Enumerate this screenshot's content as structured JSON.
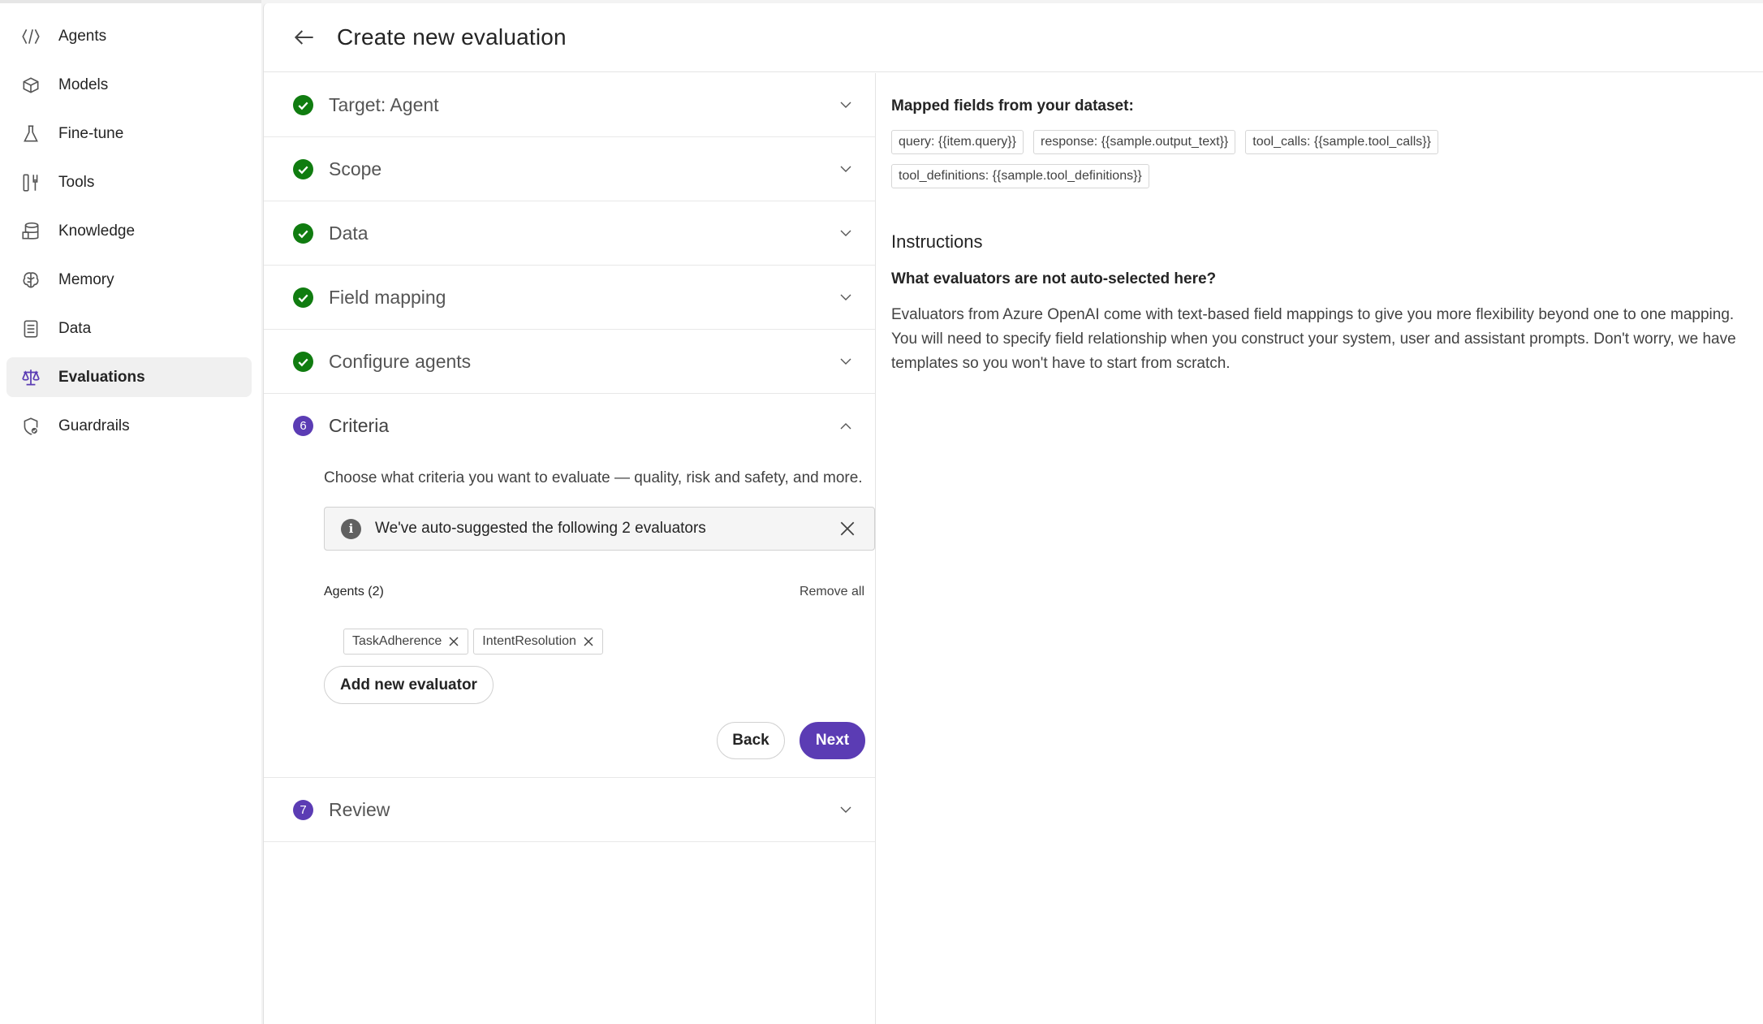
{
  "sidebar": {
    "items": [
      {
        "label": "Agents",
        "icon": "agents-icon"
      },
      {
        "label": "Models",
        "icon": "models-icon"
      },
      {
        "label": "Fine-tune",
        "icon": "flask-icon"
      },
      {
        "label": "Tools",
        "icon": "tools-icon"
      },
      {
        "label": "Knowledge",
        "icon": "database-icon"
      },
      {
        "label": "Memory",
        "icon": "brain-icon"
      },
      {
        "label": "Data",
        "icon": "document-icon"
      },
      {
        "label": "Evaluations",
        "icon": "scales-icon",
        "active": true
      },
      {
        "label": "Guardrails",
        "icon": "shield-check-icon"
      }
    ]
  },
  "header": {
    "title": "Create new evaluation"
  },
  "steps": [
    {
      "label": "Target: Agent",
      "status": "complete"
    },
    {
      "label": "Scope",
      "status": "complete"
    },
    {
      "label": "Data",
      "status": "complete"
    },
    {
      "label": "Field mapping",
      "status": "complete"
    },
    {
      "label": "Configure agents",
      "status": "complete"
    },
    {
      "label": "Criteria",
      "number": "6",
      "status": "current"
    },
    {
      "label": "Review",
      "number": "7",
      "status": "pending"
    }
  ],
  "criteria": {
    "description": "Choose what criteria you want to evaluate — quality, risk and safety, and more.",
    "info_message": "We've auto-suggested the following 2 evaluators",
    "agents_title": "Agents (2)",
    "remove_all": "Remove all",
    "chips": [
      "TaskAdherence",
      "IntentResolution"
    ],
    "add_button": "Add new evaluator",
    "back_button": "Back",
    "next_button": "Next"
  },
  "details": {
    "mapped_title": "Mapped fields from your dataset:",
    "tags": [
      "query: {{item.query}}",
      "response: {{sample.output_text}}",
      "tool_calls: {{sample.tool_calls}}",
      "tool_definitions: {{sample.tool_definitions}}"
    ],
    "instructions_title": "Instructions",
    "question": "What evaluators are not auto-selected here?",
    "explanation": "Evaluators from Azure OpenAI come with text-based field mappings to give you more flexibility beyond one to one mapping. You will need to specify field relationship when you construct your system, user and assistant prompts. Don't worry, we have templates so you won't have to start from scratch."
  },
  "colors": {
    "accent": "#5b3cb4",
    "success": "#107c10"
  }
}
